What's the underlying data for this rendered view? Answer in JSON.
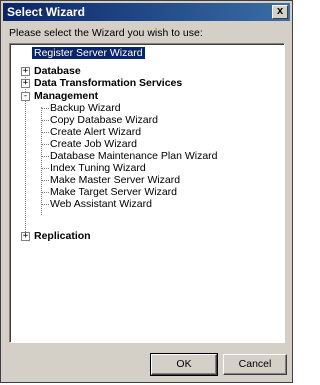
{
  "window": {
    "title": "Select Wizard",
    "close_glyph": "x"
  },
  "prompt": "Please select the Wizard you wish to use:",
  "tree": {
    "register": "Register Server Wizard",
    "database": "Database",
    "dts": "Data Transformation Services",
    "management": {
      "label": "Management",
      "children": [
        "Backup Wizard",
        "Copy Database Wizard",
        "Create Alert Wizard",
        "Create Job Wizard",
        "Database Maintenance Plan Wizard",
        "Index Tuning Wizard",
        "Make Master Server Wizard",
        "Make Target Server Wizard",
        "Web Assistant Wizard"
      ]
    },
    "replication": "Replication",
    "expander_plus": "+",
    "expander_minus": "-"
  },
  "buttons": {
    "ok": "OK",
    "cancel": "Cancel"
  }
}
